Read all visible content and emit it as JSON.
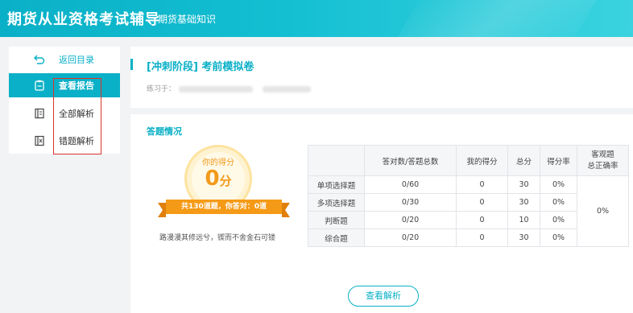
{
  "header": {
    "title": "期货从业资格考试辅导",
    "subtitle": "期货基础知识",
    "bg_color": "#0ab0c7"
  },
  "sidebar": {
    "items": [
      {
        "label": "返回目录",
        "icon": "back-arrow-icon"
      },
      {
        "label": "查看报告",
        "icon": "report-icon",
        "active": true
      },
      {
        "label": "全部解析",
        "icon": "book-list-icon"
      },
      {
        "label": "错题解析",
        "icon": "book-x-icon"
      }
    ]
  },
  "exam": {
    "title": "[冲刺阶段] 考前模拟卷",
    "practice_label": "练习于："
  },
  "answers": {
    "section_label": "答题情况",
    "score_label": "你的得分",
    "score_value": "0",
    "score_unit": "分",
    "summary": "共130道题，你答对：0道",
    "motto": "路漫漫其修远兮，锲而不舍金石可镂"
  },
  "table": {
    "headers": [
      "",
      "答对数/答题总数",
      "我的得分",
      "总分",
      "得分率",
      "客观题\n总正确率"
    ],
    "rows": [
      {
        "type": "单项选择题",
        "correct": "0/60",
        "my_score": "0",
        "total": "30",
        "rate": "0%"
      },
      {
        "type": "多项选择题",
        "correct": "0/30",
        "my_score": "0",
        "total": "30",
        "rate": "0%"
      },
      {
        "type": "判断题",
        "correct": "0/20",
        "my_score": "0",
        "total": "10",
        "rate": "0%"
      },
      {
        "type": "综合题",
        "correct": "0/20",
        "my_score": "0",
        "total": "30",
        "rate": "0%"
      }
    ],
    "overall_rate": "0%"
  },
  "actions": {
    "view_analysis": "查看解析"
  },
  "colors": {
    "accent": "#0ab0c7",
    "score_orange": "#f29a1a",
    "highlight_red": "#d9342b"
  }
}
